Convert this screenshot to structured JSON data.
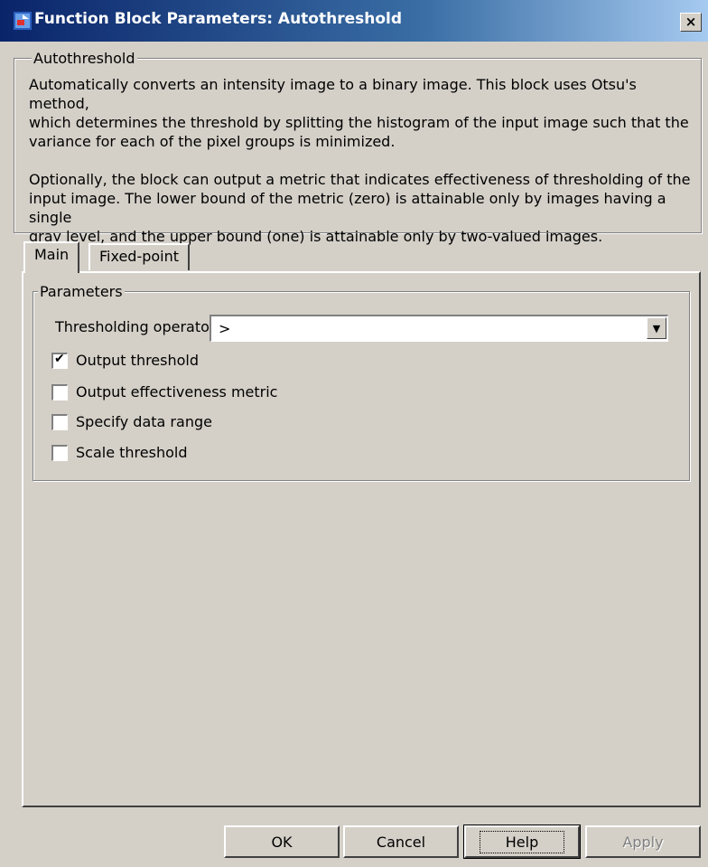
{
  "window": {
    "title": "Function Block Parameters: Autothreshold",
    "close_label": "×"
  },
  "description": {
    "group_label": "Autothreshold",
    "paragraph1_line1": "Automatically converts an intensity image to a binary image.  This block uses Otsu's method,",
    "paragraph1_line2": "which determines the threshold by splitting the histogram of the input image such that the",
    "paragraph1_line3": "variance for each of the pixel groups is minimized.",
    "paragraph2_line1": "Optionally, the block can output a metric that indicates effectiveness of thresholding of the",
    "paragraph2_line2": "input image.  The lower bound of the metric (zero) is attainable only by images having a single",
    "paragraph2_line3": "gray level, and the upper bound (one) is attainable only by two-valued images."
  },
  "tabs": [
    {
      "label": "Main",
      "active": true
    },
    {
      "label": "Fixed-point",
      "active": false
    }
  ],
  "parameters": {
    "group_label": "Parameters",
    "operator_label": "Thresholding operator:",
    "operator_value": ">",
    "checkboxes": [
      {
        "label": "Output threshold",
        "checked": true
      },
      {
        "label": "Output effectiveness metric",
        "checked": false
      },
      {
        "label": "Specify data range",
        "checked": false
      },
      {
        "label": "Scale threshold",
        "checked": false
      }
    ]
  },
  "buttons": {
    "ok": "OK",
    "cancel": "Cancel",
    "help": "Help",
    "apply": "Apply"
  },
  "icons": {
    "app": "simulink-block-icon",
    "close": "close-icon",
    "dropdown": "chevron-down-icon"
  }
}
